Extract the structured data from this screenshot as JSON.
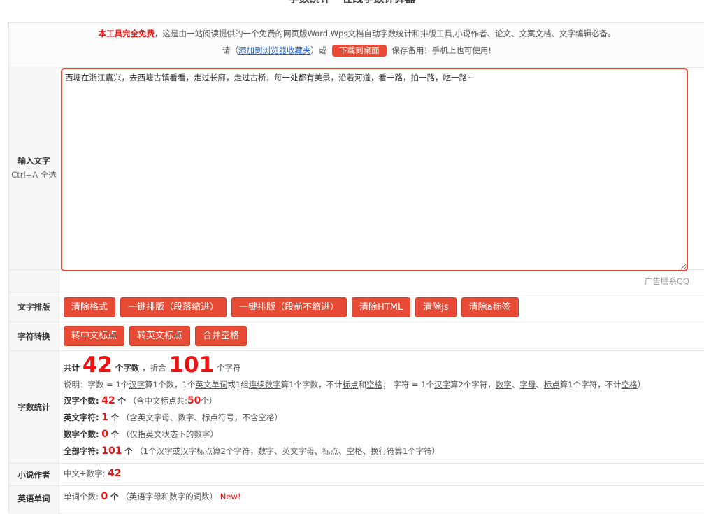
{
  "page_title": "字数统计 - 在线字数计算器",
  "notice": {
    "free": "本工具完全免费",
    "intro": "，这是由一站阅读提供的一个免费的网页版Word,Wps文档自动字数统计和排版工具,小说作者、论文、文案文档、文字编辑必备。",
    "please": "请（",
    "bookmark_link": "添加到浏览器收藏夹",
    "or": "）或",
    "download_button": "下载到桌面",
    "save_note": "保存备用！手机上也可使用!"
  },
  "input_section": {
    "label": "输入文字",
    "hint": "Ctrl+A 全选",
    "text": "西塘在浙江嘉兴，去西塘古镇看看，走过长廊，走过古桥，每一处都有美景，沿着河道，看一路，拍一路，吃一路~"
  },
  "ad_text": "广告联系QQ",
  "layout_section": {
    "label": "文字排版",
    "buttons": [
      "清除格式",
      "一键排版（段落缩进）",
      "一键排版（段前不缩进）",
      "清除HTML",
      "清除js",
      "清除a标签"
    ]
  },
  "convert_section": {
    "label": "字符转换",
    "buttons": [
      "转中文标点",
      "转英文标点",
      "合并空格"
    ]
  },
  "stats_section": {
    "label": "字数统计",
    "total_prefix": "共计",
    "total_words": "42",
    "words_unit": "个字数",
    "equiv_prefix": "，折合",
    "total_chars": "101",
    "chars_unit": "个字符",
    "explain": {
      "p1": "说明：字数 = 1个",
      "u1": "汉字",
      "p2": "算1个数，1个",
      "u2": "英文单词",
      "p3": "或1组",
      "u3": "连续数字",
      "p4": "算1个字数，不计",
      "u4": "标点",
      "p5": "和",
      "u5": "空格",
      "p6": "；  字符 = 1个",
      "u6": "汉字",
      "p7": "算2个字符，",
      "u7": "数字",
      "p8": "、",
      "u8": "字母",
      "p9": "、",
      "u9": "标点",
      "p10": "算1个字符，不计",
      "u10": "空格",
      "p11": "）"
    },
    "chinese": {
      "label": "汉字个数:",
      "value": "42",
      "unit": "个",
      "note_prefix": "（含中文标点共:",
      "punct": "50",
      "note_suffix": "个）"
    },
    "english": {
      "label": "英文字符:",
      "value": "1",
      "unit": "个",
      "note": "（含英文字母、数字、标点符号，不含空格）"
    },
    "digits": {
      "label": "数字个数:",
      "value": "0",
      "unit": "个",
      "note": "（仅指英文状态下的数字）"
    },
    "all": {
      "label": "全部字符:",
      "value": "101",
      "unit": "个",
      "n1": "（1个",
      "u1": "汉字",
      "n2": "或",
      "u2": "汉字标点",
      "n3": "算2个字符，",
      "u3": "数字",
      "n4": "、",
      "u4": "英文字母",
      "n5": "、",
      "u5": "标点",
      "n6": "、",
      "u6": "空格",
      "n7": "、",
      "u7": "换行符",
      "n8": "算1个字符）"
    }
  },
  "novel_section": {
    "label": "小说作者",
    "text": "中文+数字:",
    "value": "42"
  },
  "english_section": {
    "label": "英语单词",
    "text": "单词个数:",
    "value": "0",
    "unit": "个",
    "note": "（英语字母和数字的词数）",
    "new_badge": "New!"
  }
}
